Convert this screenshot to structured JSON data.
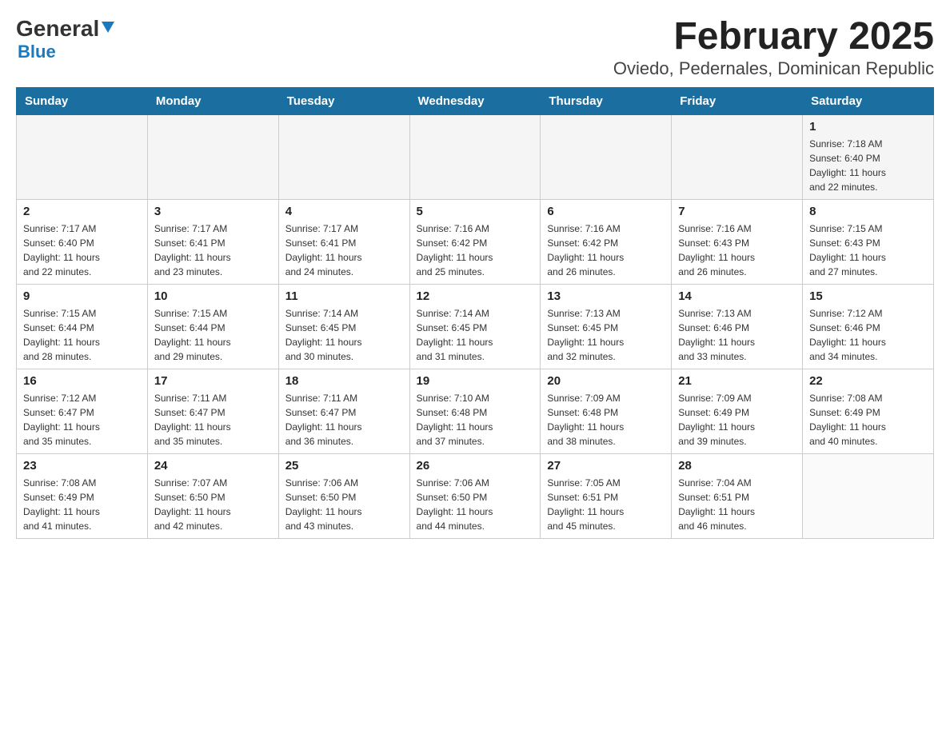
{
  "header": {
    "logo": {
      "general": "General",
      "blue": "Blue"
    },
    "title": "February 2025",
    "subtitle": "Oviedo, Pedernales, Dominican Republic"
  },
  "calendar": {
    "days": [
      "Sunday",
      "Monday",
      "Tuesday",
      "Wednesday",
      "Thursday",
      "Friday",
      "Saturday"
    ],
    "weeks": [
      {
        "cells": [
          {
            "day": "",
            "info": ""
          },
          {
            "day": "",
            "info": ""
          },
          {
            "day": "",
            "info": ""
          },
          {
            "day": "",
            "info": ""
          },
          {
            "day": "",
            "info": ""
          },
          {
            "day": "",
            "info": ""
          },
          {
            "day": "1",
            "info": "Sunrise: 7:18 AM\nSunset: 6:40 PM\nDaylight: 11 hours\nand 22 minutes."
          }
        ]
      },
      {
        "cells": [
          {
            "day": "2",
            "info": "Sunrise: 7:17 AM\nSunset: 6:40 PM\nDaylight: 11 hours\nand 22 minutes."
          },
          {
            "day": "3",
            "info": "Sunrise: 7:17 AM\nSunset: 6:41 PM\nDaylight: 11 hours\nand 23 minutes."
          },
          {
            "day": "4",
            "info": "Sunrise: 7:17 AM\nSunset: 6:41 PM\nDaylight: 11 hours\nand 24 minutes."
          },
          {
            "day": "5",
            "info": "Sunrise: 7:16 AM\nSunset: 6:42 PM\nDaylight: 11 hours\nand 25 minutes."
          },
          {
            "day": "6",
            "info": "Sunrise: 7:16 AM\nSunset: 6:42 PM\nDaylight: 11 hours\nand 26 minutes."
          },
          {
            "day": "7",
            "info": "Sunrise: 7:16 AM\nSunset: 6:43 PM\nDaylight: 11 hours\nand 26 minutes."
          },
          {
            "day": "8",
            "info": "Sunrise: 7:15 AM\nSunset: 6:43 PM\nDaylight: 11 hours\nand 27 minutes."
          }
        ]
      },
      {
        "cells": [
          {
            "day": "9",
            "info": "Sunrise: 7:15 AM\nSunset: 6:44 PM\nDaylight: 11 hours\nand 28 minutes."
          },
          {
            "day": "10",
            "info": "Sunrise: 7:15 AM\nSunset: 6:44 PM\nDaylight: 11 hours\nand 29 minutes."
          },
          {
            "day": "11",
            "info": "Sunrise: 7:14 AM\nSunset: 6:45 PM\nDaylight: 11 hours\nand 30 minutes."
          },
          {
            "day": "12",
            "info": "Sunrise: 7:14 AM\nSunset: 6:45 PM\nDaylight: 11 hours\nand 31 minutes."
          },
          {
            "day": "13",
            "info": "Sunrise: 7:13 AM\nSunset: 6:45 PM\nDaylight: 11 hours\nand 32 minutes."
          },
          {
            "day": "14",
            "info": "Sunrise: 7:13 AM\nSunset: 6:46 PM\nDaylight: 11 hours\nand 33 minutes."
          },
          {
            "day": "15",
            "info": "Sunrise: 7:12 AM\nSunset: 6:46 PM\nDaylight: 11 hours\nand 34 minutes."
          }
        ]
      },
      {
        "cells": [
          {
            "day": "16",
            "info": "Sunrise: 7:12 AM\nSunset: 6:47 PM\nDaylight: 11 hours\nand 35 minutes."
          },
          {
            "day": "17",
            "info": "Sunrise: 7:11 AM\nSunset: 6:47 PM\nDaylight: 11 hours\nand 35 minutes."
          },
          {
            "day": "18",
            "info": "Sunrise: 7:11 AM\nSunset: 6:47 PM\nDaylight: 11 hours\nand 36 minutes."
          },
          {
            "day": "19",
            "info": "Sunrise: 7:10 AM\nSunset: 6:48 PM\nDaylight: 11 hours\nand 37 minutes."
          },
          {
            "day": "20",
            "info": "Sunrise: 7:09 AM\nSunset: 6:48 PM\nDaylight: 11 hours\nand 38 minutes."
          },
          {
            "day": "21",
            "info": "Sunrise: 7:09 AM\nSunset: 6:49 PM\nDaylight: 11 hours\nand 39 minutes."
          },
          {
            "day": "22",
            "info": "Sunrise: 7:08 AM\nSunset: 6:49 PM\nDaylight: 11 hours\nand 40 minutes."
          }
        ]
      },
      {
        "cells": [
          {
            "day": "23",
            "info": "Sunrise: 7:08 AM\nSunset: 6:49 PM\nDaylight: 11 hours\nand 41 minutes."
          },
          {
            "day": "24",
            "info": "Sunrise: 7:07 AM\nSunset: 6:50 PM\nDaylight: 11 hours\nand 42 minutes."
          },
          {
            "day": "25",
            "info": "Sunrise: 7:06 AM\nSunset: 6:50 PM\nDaylight: 11 hours\nand 43 minutes."
          },
          {
            "day": "26",
            "info": "Sunrise: 7:06 AM\nSunset: 6:50 PM\nDaylight: 11 hours\nand 44 minutes."
          },
          {
            "day": "27",
            "info": "Sunrise: 7:05 AM\nSunset: 6:51 PM\nDaylight: 11 hours\nand 45 minutes."
          },
          {
            "day": "28",
            "info": "Sunrise: 7:04 AM\nSunset: 6:51 PM\nDaylight: 11 hours\nand 46 minutes."
          },
          {
            "day": "",
            "info": ""
          }
        ]
      }
    ]
  }
}
